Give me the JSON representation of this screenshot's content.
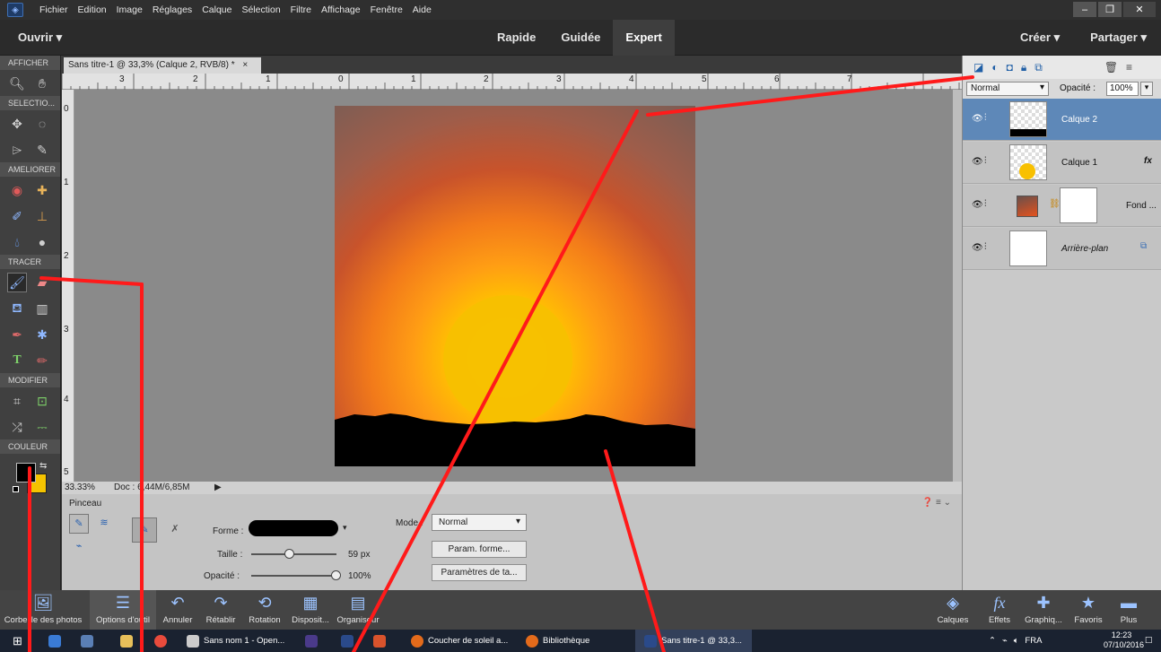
{
  "menubar": {
    "items": [
      "Fichier",
      "Edition",
      "Image",
      "Réglages",
      "Calque",
      "Sélection",
      "Filtre",
      "Affichage",
      "Fenêtre",
      "Aide"
    ]
  },
  "modebar": {
    "open": "Ouvrir",
    "modes": [
      "Rapide",
      "Guidée",
      "Expert"
    ],
    "active_mode": "Expert",
    "create": "Créer",
    "share": "Partager"
  },
  "toolbox": {
    "sections": {
      "view": "AFFICHER",
      "select": "SELECTIO...",
      "enhance": "AMELIORER",
      "draw": "TRACER",
      "modify": "MODIFIER",
      "color": "COULEUR"
    },
    "foreground_color": "#000000",
    "background_color": "#f5c400"
  },
  "document": {
    "tab_title": "Sans titre-1 @ 33,3% (Calque 2, RVB/8) *",
    "ruler_h_labels": [
      "3",
      "2",
      "1",
      "0",
      "1",
      "2",
      "3",
      "4",
      "5",
      "6",
      "7"
    ],
    "ruler_v_labels": [
      "0",
      "1",
      "2",
      "3",
      "4",
      "5"
    ],
    "zoom": "33.33%",
    "doc_info": "Doc : 6,44M/6,85M"
  },
  "options": {
    "title": "Pinceau",
    "shape_label": "Forme :",
    "size_label": "Taille :",
    "size_value": "59 px",
    "size_percent": 0.45,
    "opacity_label": "Opacité :",
    "opacity_value": "100%",
    "opacity_percent": 1.0,
    "mode_label": "Mode :",
    "mode_value": "Normal",
    "btn_shape": "Param. forme...",
    "btn_tablet": "Paramètres de ta..."
  },
  "layers": {
    "blend_mode": "Normal",
    "opacity_label": "Opacité :",
    "opacity_value": "100%",
    "items": [
      {
        "name": "Calque 2",
        "active": true,
        "fx": ""
      },
      {
        "name": "Calque 1",
        "active": false,
        "fx": "fx"
      },
      {
        "name": "Fond ...",
        "active": false,
        "fx": ""
      },
      {
        "name": "Arrière-plan",
        "active": false,
        "fx": ""
      }
    ]
  },
  "tray": {
    "left": [
      "Corbeille des photos",
      "Options d'outil",
      "Annuler",
      "Rétablir",
      "Rotation",
      "Disposit...",
      "Organiseur"
    ],
    "right": [
      "Calques",
      "Effets",
      "Graphiq...",
      "Favoris",
      "Plus"
    ]
  },
  "taskbar": {
    "items": [
      "Sans nom 1 - Open...",
      "Coucher de soleil a...",
      "Bibliothèque",
      "Sans titre-1 @ 33,3..."
    ],
    "lang": "FRA",
    "time": "12:23",
    "date": "07/10/2016"
  }
}
